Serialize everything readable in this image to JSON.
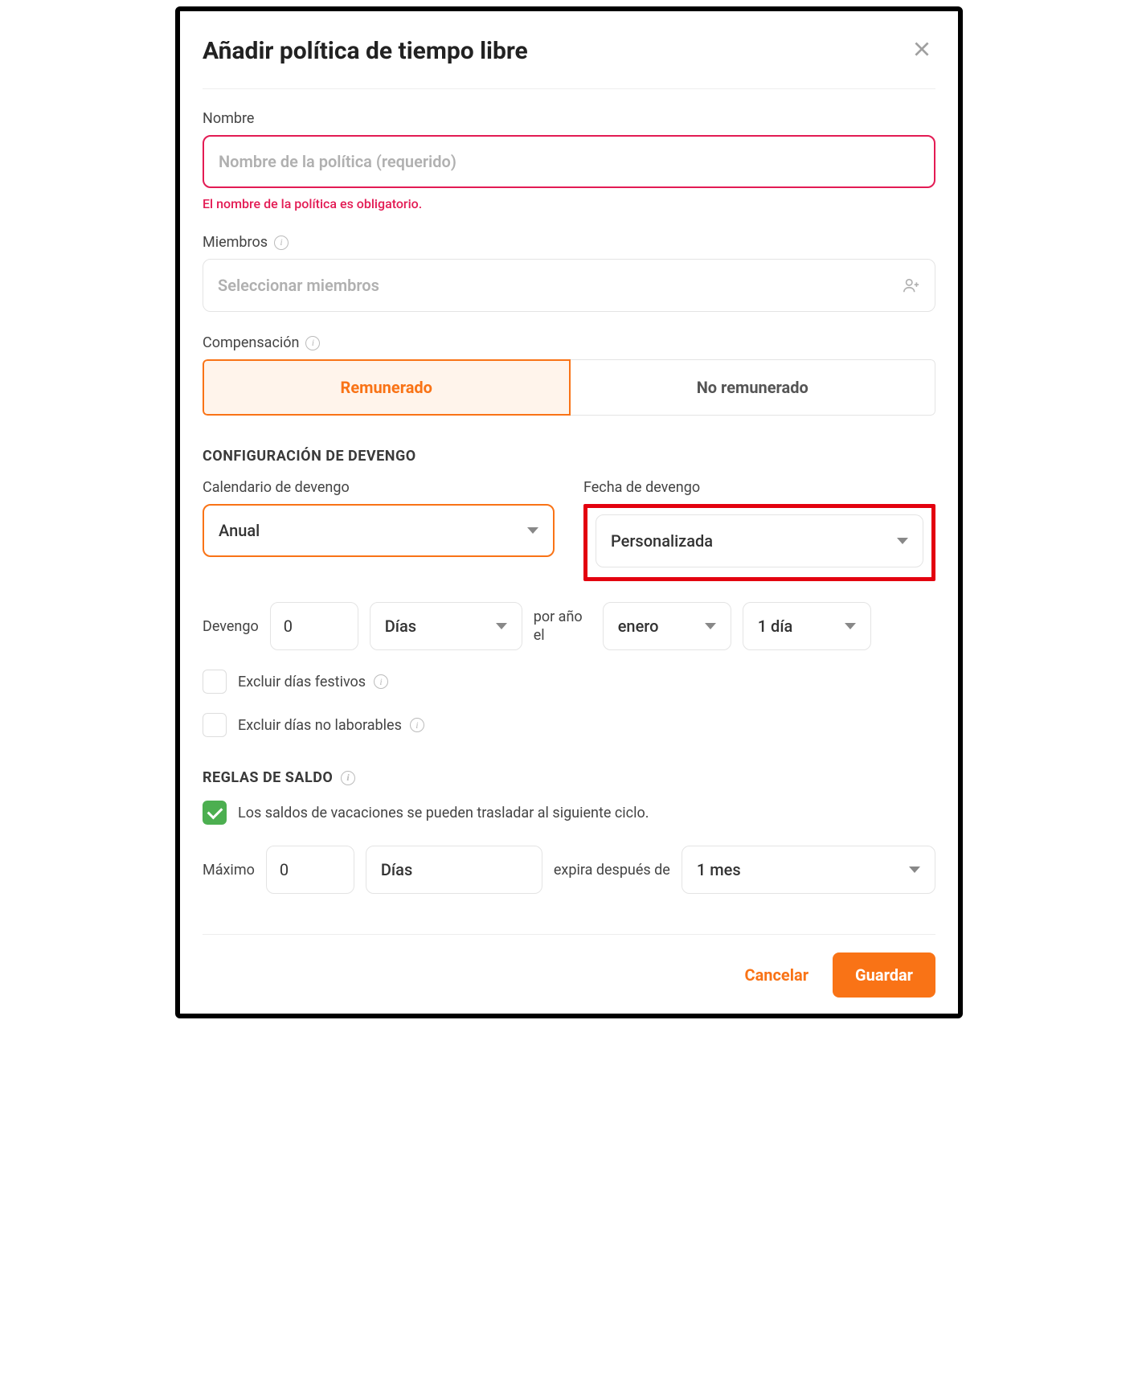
{
  "modal": {
    "title": "Añadir política de tiempo libre"
  },
  "name": {
    "label": "Nombre",
    "placeholder": "Nombre de la política (requerido)",
    "error": "El nombre de la política es obligatorio."
  },
  "members": {
    "label": "Miembros",
    "placeholder": "Seleccionar miembros"
  },
  "compensation": {
    "label": "Compensación",
    "paid": "Remunerado",
    "unpaid": "No remunerado"
  },
  "accrual": {
    "section": "CONFIGURACIÓN DE DEVENGO",
    "schedule_label": "Calendario de devengo",
    "schedule_value": "Anual",
    "date_label": "Fecha de devengo",
    "date_value": "Personalizada",
    "accrue_label": "Devengo",
    "accrue_amount": "0",
    "unit": "Días",
    "per_year": "por año el",
    "month": "enero",
    "day": "1 día",
    "exclude_holidays": "Excluir días festivos",
    "exclude_nonworking": "Excluir días no laborables"
  },
  "balance": {
    "section": "REGLAS DE SALDO",
    "rollover": "Los saldos de vacaciones se pueden trasladar al siguiente ciclo.",
    "max_label": "Máximo",
    "max_value": "0",
    "unit": "Días",
    "expires_label": "expira después de",
    "expires_value": "1 mes"
  },
  "footer": {
    "cancel": "Cancelar",
    "save": "Guardar"
  }
}
